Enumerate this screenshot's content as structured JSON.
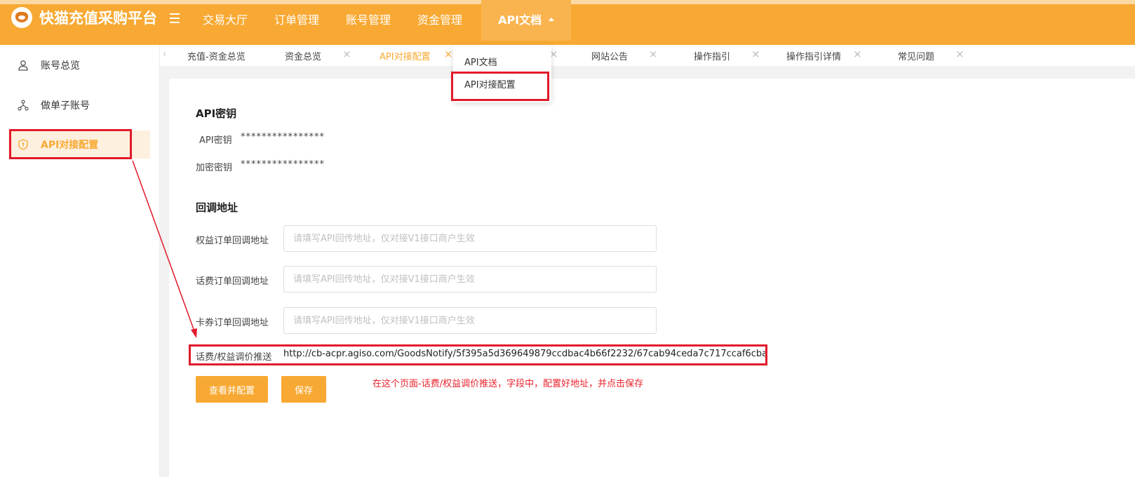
{
  "app": {
    "title": "快猫充值采购平台"
  },
  "topnav": {
    "items": [
      {
        "label": "交易大厅"
      },
      {
        "label": "订单管理"
      },
      {
        "label": "账号管理"
      },
      {
        "label": "资金管理"
      },
      {
        "label": "API文档"
      }
    ],
    "active_index": 4
  },
  "sidebar": {
    "items": [
      {
        "label": "账号总览",
        "icon": "user-icon"
      },
      {
        "label": "做单子账号",
        "icon": "tree-icon"
      },
      {
        "label": "API对接配置",
        "icon": "shield-icon"
      }
    ],
    "active_index": 2
  },
  "tabs": [
    {
      "label": "充值-资金总览"
    },
    {
      "label": "资金总览"
    },
    {
      "label": "API对接配置"
    },
    {
      "label": "网站公告"
    },
    {
      "label": "操作指引"
    },
    {
      "label": "操作指引详情"
    },
    {
      "label": "常见问题"
    }
  ],
  "dropdown": {
    "items": [
      {
        "label": "API文档"
      },
      {
        "label": "API对接配置"
      }
    ]
  },
  "api_key_section": {
    "title": "API密钥",
    "api_key_label": "API密钥",
    "api_key_value": "****************",
    "encrypt_key_label": "加密密钥",
    "encrypt_key_value": "****************"
  },
  "callback_section": {
    "title": "回调地址",
    "fields": [
      {
        "label": "权益订单回调地址",
        "placeholder": "请填写API回传地址，仅对接V1接口商户生效"
      },
      {
        "label": "话费订单回调地址",
        "placeholder": "请填写API回传地址，仅对接V1接口商户生效"
      },
      {
        "label": "卡券订单回调地址",
        "placeholder": "请填写API回传地址，仅对接V1接口商户生效"
      }
    ],
    "price_push_label": "话费/权益调价推送",
    "price_push_value": "http://cb-acpr.agiso.com/GoodsNotify/5f395a5d369649879ccdbac4b66f2232/67cab94ceda7c717ccaf6cba"
  },
  "buttons": {
    "view_config": "查看并配置",
    "save": "保存"
  },
  "annotation": {
    "note": "在这个页面-话费/权益调价推送，字段中，配置好地址，并点击保存"
  },
  "colors": {
    "brand": "#f8a933",
    "highlight": "#e11a2b"
  }
}
